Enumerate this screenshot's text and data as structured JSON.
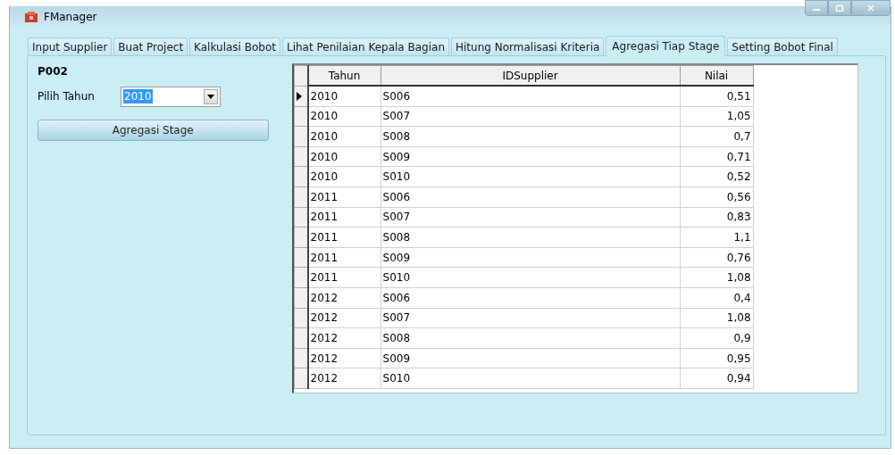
{
  "window": {
    "title": "FManager"
  },
  "tabs": [
    {
      "label": "Input Supplier",
      "selected": false
    },
    {
      "label": "Buat Project",
      "selected": false
    },
    {
      "label": "Kalkulasi Bobot",
      "selected": false
    },
    {
      "label": "Lihat Penilaian Kepala Bagian",
      "selected": false
    },
    {
      "label": "Hitung Normalisasi Kriteria",
      "selected": false
    },
    {
      "label": "Agregasi Tiap Stage",
      "selected": true
    },
    {
      "label": "Setting Bobot Final",
      "selected": false
    }
  ],
  "project_code": "P002",
  "year_picker": {
    "label": "Pilih Tahun",
    "value": "2010"
  },
  "action_button": "Agregasi Stage",
  "table": {
    "columns": [
      "Tahun",
      "IDSupplier",
      "Nilai"
    ],
    "rows": [
      {
        "cells": [
          "2010",
          "S006",
          "0,51"
        ],
        "selected": true
      },
      {
        "cells": [
          "2010",
          "S007",
          "1,05"
        ],
        "selected": false
      },
      {
        "cells": [
          "2010",
          "S008",
          "0,7"
        ],
        "selected": false
      },
      {
        "cells": [
          "2010",
          "S009",
          "0,71"
        ],
        "selected": false
      },
      {
        "cells": [
          "2010",
          "S010",
          "0,52"
        ],
        "selected": false
      },
      {
        "cells": [
          "2011",
          "S006",
          "0,56"
        ],
        "selected": false
      },
      {
        "cells": [
          "2011",
          "S007",
          "0,83"
        ],
        "selected": false
      },
      {
        "cells": [
          "2011",
          "S008",
          "1,1"
        ],
        "selected": false
      },
      {
        "cells": [
          "2011",
          "S009",
          "0,76"
        ],
        "selected": false
      },
      {
        "cells": [
          "2011",
          "S010",
          "1,08"
        ],
        "selected": false
      },
      {
        "cells": [
          "2012",
          "S006",
          "0,4"
        ],
        "selected": false
      },
      {
        "cells": [
          "2012",
          "S007",
          "1,08"
        ],
        "selected": false
      },
      {
        "cells": [
          "2012",
          "S008",
          "0,9"
        ],
        "selected": false
      },
      {
        "cells": [
          "2012",
          "S009",
          "0,95"
        ],
        "selected": false
      },
      {
        "cells": [
          "2012",
          "S010",
          "0,94"
        ],
        "selected": false
      }
    ]
  }
}
